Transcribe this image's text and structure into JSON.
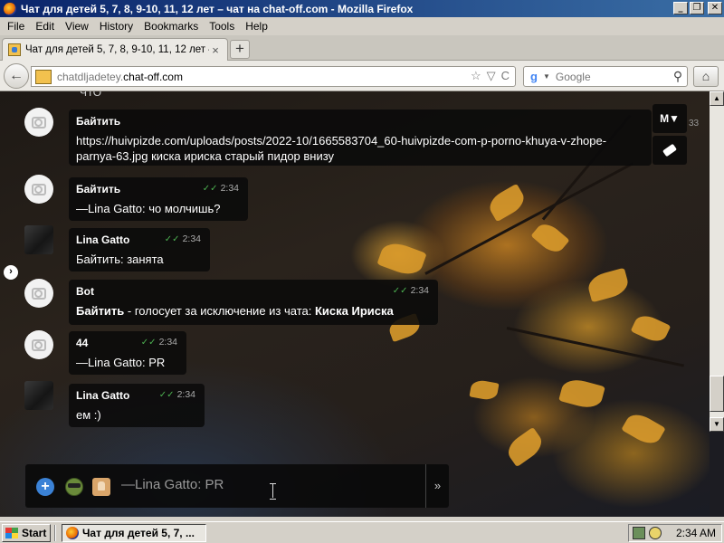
{
  "window": {
    "title": "Чат для детей 5, 7, 8, 9-10, 11, 12 лет – чат на chat-off.com - Mozilla Firefox",
    "minimize": "_",
    "maximize": "❐",
    "close": "✕"
  },
  "menu": [
    "File",
    "Edit",
    "View",
    "History",
    "Bookmarks",
    "Tools",
    "Help"
  ],
  "tab": {
    "label": "Чат для детей 5, 7, 8, 9-10, 11, 12 лет – чат...",
    "close": "×",
    "new_tab": "+"
  },
  "navbar": {
    "back": "←",
    "url_sub": "chatdljadetey.",
    "url_host": "chat-off.com",
    "bookmark_star": "☆",
    "dropdown": "▽",
    "reload": "C",
    "search_engine": "g",
    "search_placeholder": "Google",
    "search_icon": "⚲",
    "home": "⌂"
  },
  "chat": {
    "messages": [
      {
        "author": "Байтить",
        "time": "",
        "text": "https://huivpizde.com/uploads/posts/2022-10/1665583704_60-huivpizde-com-p-porno-khuya-v-zhope-parnya-63.jpg киска ириска старый пидор внизу"
      },
      {
        "author": "Байтить",
        "time": "2:34",
        "text": "—Lina Gatto: чо молчишь?"
      },
      {
        "author": "Lina Gatto",
        "time": "2:34",
        "text": "Байтить: занята"
      },
      {
        "author": "Bot",
        "time": "2:34",
        "text_bold_1": "Байтить",
        "text_mid": " - голосует за исключение из чата: ",
        "text_bold_2": "Киска Ириска"
      },
      {
        "author": "44",
        "time": "2:34",
        "text": "—Lina Gatto: PR"
      },
      {
        "author": "Lina Gatto",
        "time": "2:34",
        "text": "ем :)"
      }
    ],
    "partial_top": "ЧТО",
    "edge_time": "33",
    "checkmark": "✓✓",
    "side_tool_m": "M▼",
    "composer": {
      "text": "—Lina Gatto: PR",
      "send": "»",
      "plus": "+"
    },
    "left_arrow": "›"
  },
  "taskbar": {
    "start": "Start",
    "task_label": "Чат для детей 5, 7, ...",
    "clock": "2:34 AM"
  }
}
